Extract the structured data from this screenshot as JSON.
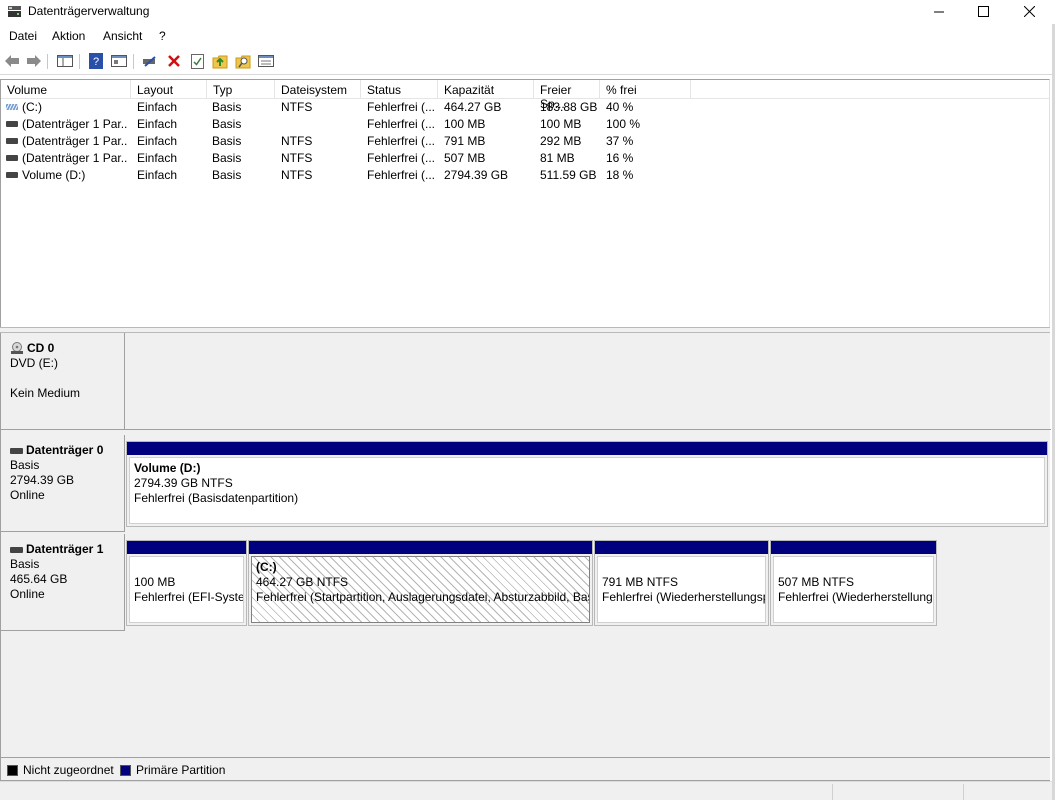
{
  "window": {
    "title": "Datenträgerverwaltung"
  },
  "menu": [
    "Datei",
    "Aktion",
    "Ansicht",
    "?"
  ],
  "toolbar_icons": [
    "back-icon",
    "forward-icon",
    "console-tree-icon",
    "help-icon",
    "properties-icon",
    "connect-icon",
    "delete-icon",
    "check-icon",
    "folder-up-icon",
    "search-icon",
    "list-icon"
  ],
  "volume_list": {
    "columns": [
      "Volume",
      "Layout",
      "Typ",
      "Dateisystem",
      "Status",
      "Kapazität",
      "Freier Sp...",
      "% frei"
    ],
    "rows": [
      [
        "(C:)",
        "Einfach",
        "Basis",
        "NTFS",
        "Fehlerfrei (...",
        "464.27 GB",
        "183.88 GB",
        "40 %"
      ],
      [
        "(Datenträger 1 Par...",
        "Einfach",
        "Basis",
        "",
        "Fehlerfrei (...",
        "100 MB",
        "100 MB",
        "100 %"
      ],
      [
        "(Datenträger 1 Par...",
        "Einfach",
        "Basis",
        "NTFS",
        "Fehlerfrei (...",
        "791 MB",
        "292 MB",
        "37 %"
      ],
      [
        "(Datenträger 1 Par...",
        "Einfach",
        "Basis",
        "NTFS",
        "Fehlerfrei (...",
        "507 MB",
        "81 MB",
        "16 %"
      ],
      [
        "Volume (D:)",
        "Einfach",
        "Basis",
        "NTFS",
        "Fehlerfrei (...",
        "2794.39 GB",
        "511.59 GB",
        "18 %"
      ]
    ]
  },
  "disks": {
    "cd0": {
      "name": "CD 0",
      "type": "DVD (E:)",
      "media": "Kein Medium"
    },
    "disk0": {
      "name": "Datenträger 0",
      "type": "Basis",
      "size": "2794.39 GB",
      "state": "Online",
      "partitions": [
        {
          "title": "Volume  (D:)",
          "size": "2794.39 GB NTFS",
          "status": "Fehlerfrei (Basisdatenpartition)"
        }
      ]
    },
    "disk1": {
      "name": "Datenträger 1",
      "type": "Basis",
      "size": "465.64 GB",
      "state": "Online",
      "partitions": [
        {
          "title": "",
          "size": "100 MB",
          "status": "Fehlerfrei (EFI-Systempartition)"
        },
        {
          "title": "(C:)",
          "size": "464.27 GB NTFS",
          "status": "Fehlerfrei (Startpartition, Auslagerungsdatei, Absturzabbild, Basisdatenpartition)"
        },
        {
          "title": "",
          "size": "791 MB NTFS",
          "status": "Fehlerfrei (Wiederherstellungspartition)"
        },
        {
          "title": "",
          "size": "507 MB NTFS",
          "status": "Fehlerfrei (Wiederherstellungspartition)"
        }
      ]
    }
  },
  "legend": [
    {
      "label": "Nicht zugeordnet",
      "color": "#000000"
    },
    {
      "label": "Primäre Partition",
      "color": "#00007f"
    }
  ],
  "colors": {
    "primary_partition": "#00007f",
    "pane_bg": "#f0f0f0"
  }
}
